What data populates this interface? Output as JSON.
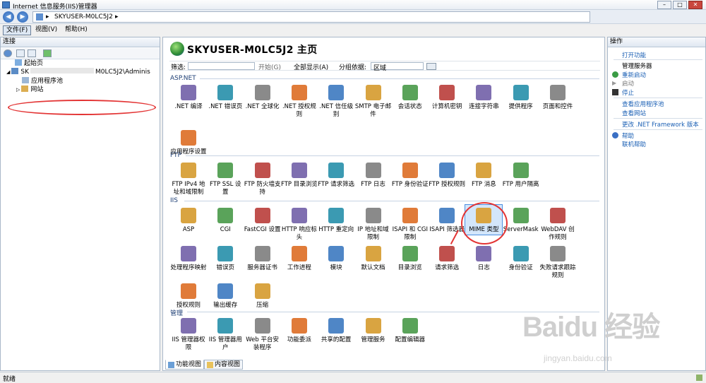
{
  "window": {
    "title": "Internet 信息服务(IIS)管理器",
    "minimize": "–",
    "maximize": "□",
    "close": "✕"
  },
  "address": {
    "sep1": "▸",
    "server": "SKYUSER-M0LC5J2",
    "sep2": "▸"
  },
  "menu": {
    "file": "文件(F)",
    "view": "视图(V)",
    "help": "帮助(H)"
  },
  "left": {
    "header": "连接",
    "tree": {
      "start_page": "起始页",
      "server": "SK",
      "server_suffix": "M0LC5J2\\Adminis",
      "app_pools": "应用程序池",
      "sites": "网站"
    }
  },
  "main": {
    "title": "SKYUSER-M0LC5J2 主页",
    "filter_label": "筛选:",
    "start_label": "开始(G)",
    "show_all_label": "全部显示(A)",
    "group_label": "分组依据:",
    "group_value": "区域",
    "sections": {
      "aspnet": "ASP.NET",
      "ftp": "FTP",
      "iis": "IIS",
      "manage": "管理"
    },
    "aspnet_items": [
      ".NET 编译",
      ".NET 错误页",
      ".NET 全球化",
      ".NET 授权规则",
      ".NET 信任级别",
      "SMTP 电子邮件",
      "会话状态",
      "计算机密钥",
      "连接字符串",
      "提供程序",
      "页面和控件",
      "应用程序设置"
    ],
    "ftp_items": [
      "FTP IPv4 地址和域限制",
      "FTP SSL 设置",
      "FTP 防火墙支持",
      "FTP 目录浏览",
      "FTP 请求筛选",
      "FTP 日志",
      "FTP 身份验证",
      "FTP 授权规则",
      "FTP 消息",
      "FTP 用户隔离"
    ],
    "iis_items": [
      "ASP",
      "CGI",
      "FastCGI 设置",
      "HTTP 响应标头",
      "HTTP 重定向",
      "IP 地址和域限制",
      "ISAPI 和 CGI 限制",
      "ISAPI 筛选器",
      "MIME 类型",
      "ServerMask",
      "WebDAV 创作规则",
      "处理程序映射",
      "错误页",
      "服务器证书",
      "工作进程",
      "模块",
      "默认文档",
      "目录浏览",
      "请求筛选",
      "日志",
      "身份验证",
      "失败请求跟踪规则",
      "授权规则",
      "输出缓存",
      "压缩"
    ],
    "manage_items": [
      "IIS 管理器权限",
      "IIS 管理器用户",
      "Web 平台安装程序",
      "功能委派",
      "共享的配置",
      "管理服务",
      "配置编辑器"
    ],
    "tabs": {
      "features": "功能视图",
      "content": "内容视图"
    }
  },
  "actions": {
    "header": "操作",
    "open_feature": "打开功能",
    "manage_server": "管理服务器",
    "restart": "重新启动",
    "start": "启动",
    "stop": "停止",
    "view_pools": "查看应用程序池",
    "view_sites": "查看网站",
    "change_net": "更改 .NET Framework 版本",
    "help": "帮助",
    "online_help": "联机帮助"
  },
  "status": {
    "text": "就绪"
  },
  "watermark": {
    "brand": "Baidu 经验",
    "url": "jingyan.baidu.com"
  },
  "colors": {
    "highlight": "#d3e6fb",
    "annotation": "#e33434",
    "link": "#1a5fb4"
  }
}
